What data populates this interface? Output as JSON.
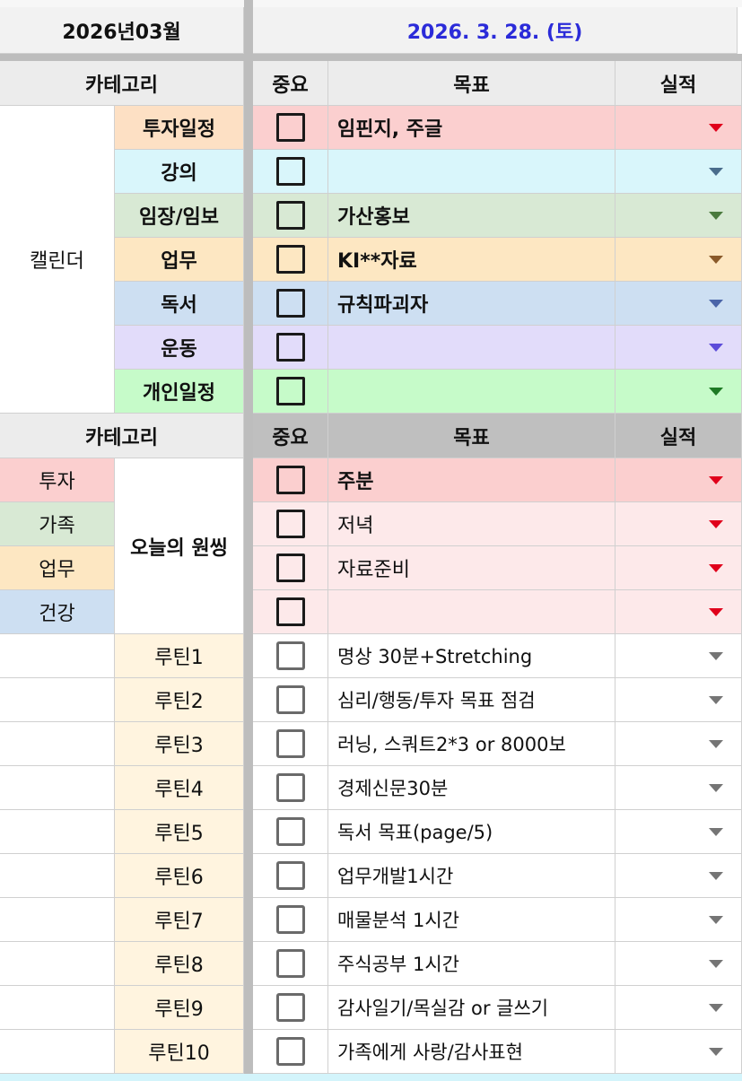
{
  "header": {
    "month": "2026년03월",
    "date": "2026. 3. 28. (토)"
  },
  "calendar_section": {
    "category_header": "카테고리",
    "importance_header": "중요",
    "goal_header": "목표",
    "result_header": "실적",
    "group_label": "캘린더",
    "rows": [
      {
        "label": "투자일정",
        "goal": "임핀지, 주글",
        "bg": "#fbcfcf",
        "label_bg": "#fde0c4",
        "arrow": "#e0001b"
      },
      {
        "label": "강의",
        "goal": "",
        "bg": "#d9f6fb",
        "label_bg": "#d9f6fb",
        "arrow": "#4a6d8c"
      },
      {
        "label": "임장/임보",
        "goal": "가산홍보",
        "bg": "#d8e9d4",
        "label_bg": "#d8e9d4",
        "arrow": "#4b7a3e"
      },
      {
        "label": "업무",
        "goal": "KI**자료",
        "bg": "#fde7c2",
        "label_bg": "#fde7c2",
        "arrow": "#8a5a2a"
      },
      {
        "label": "독서",
        "goal": "규칙파괴자",
        "bg": "#cddff2",
        "label_bg": "#cddff2",
        "arrow": "#4a64a8"
      },
      {
        "label": "운동",
        "goal": "",
        "bg": "#e2dcfa",
        "label_bg": "#e2dcfa",
        "arrow": "#5c4cd9"
      },
      {
        "label": "개인일정",
        "goal": "",
        "bg": "#c6fbc9",
        "label_bg": "#c6fbc9",
        "arrow": "#1e7a25"
      }
    ]
  },
  "one_thing_section": {
    "category_header": "카테고리",
    "importance_header": "중요",
    "goal_header": "목표",
    "result_header": "실적",
    "group_label": "오늘의 원씽",
    "left_labels": [
      {
        "label": "투자",
        "bg": "#fbcfcf"
      },
      {
        "label": "가족",
        "bg": "#d8e9d4"
      },
      {
        "label": "업무",
        "bg": "#fde7c2"
      },
      {
        "label": "건강",
        "bg": "#cddff2"
      }
    ],
    "rows": [
      {
        "goal": "주분",
        "bold": true,
        "bg": "#fbcfcf"
      },
      {
        "goal": "저녁",
        "bold": false,
        "bg": "#fde9ea"
      },
      {
        "goal": "자료준비",
        "bold": false,
        "bg": "#fde9ea"
      },
      {
        "goal": "",
        "bold": false,
        "bg": "#fde9ea"
      }
    ]
  },
  "routines": [
    {
      "label": "루틴1",
      "goal": "명상 30분+Stretching"
    },
    {
      "label": "루틴2",
      "goal": "심리/행동/투자 목표 점검"
    },
    {
      "label": "루틴3",
      "goal": "러닝, 스쿼트2*3 or 8000보"
    },
    {
      "label": "루틴4",
      "goal": "경제신문30분"
    },
    {
      "label": "루틴5",
      "goal": "독서 목표(page/5)"
    },
    {
      "label": "루틴6",
      "goal": "업무개발1시간"
    },
    {
      "label": "루틴7",
      "goal": "매물분석 1시간"
    },
    {
      "label": "루틴8",
      "goal": "주식공부 1시간"
    },
    {
      "label": "루틴9",
      "goal": "감사일기/목실감 or 글쓰기"
    },
    {
      "label": "루틴10",
      "goal": "가족에게 사랑/감사표현"
    }
  ]
}
